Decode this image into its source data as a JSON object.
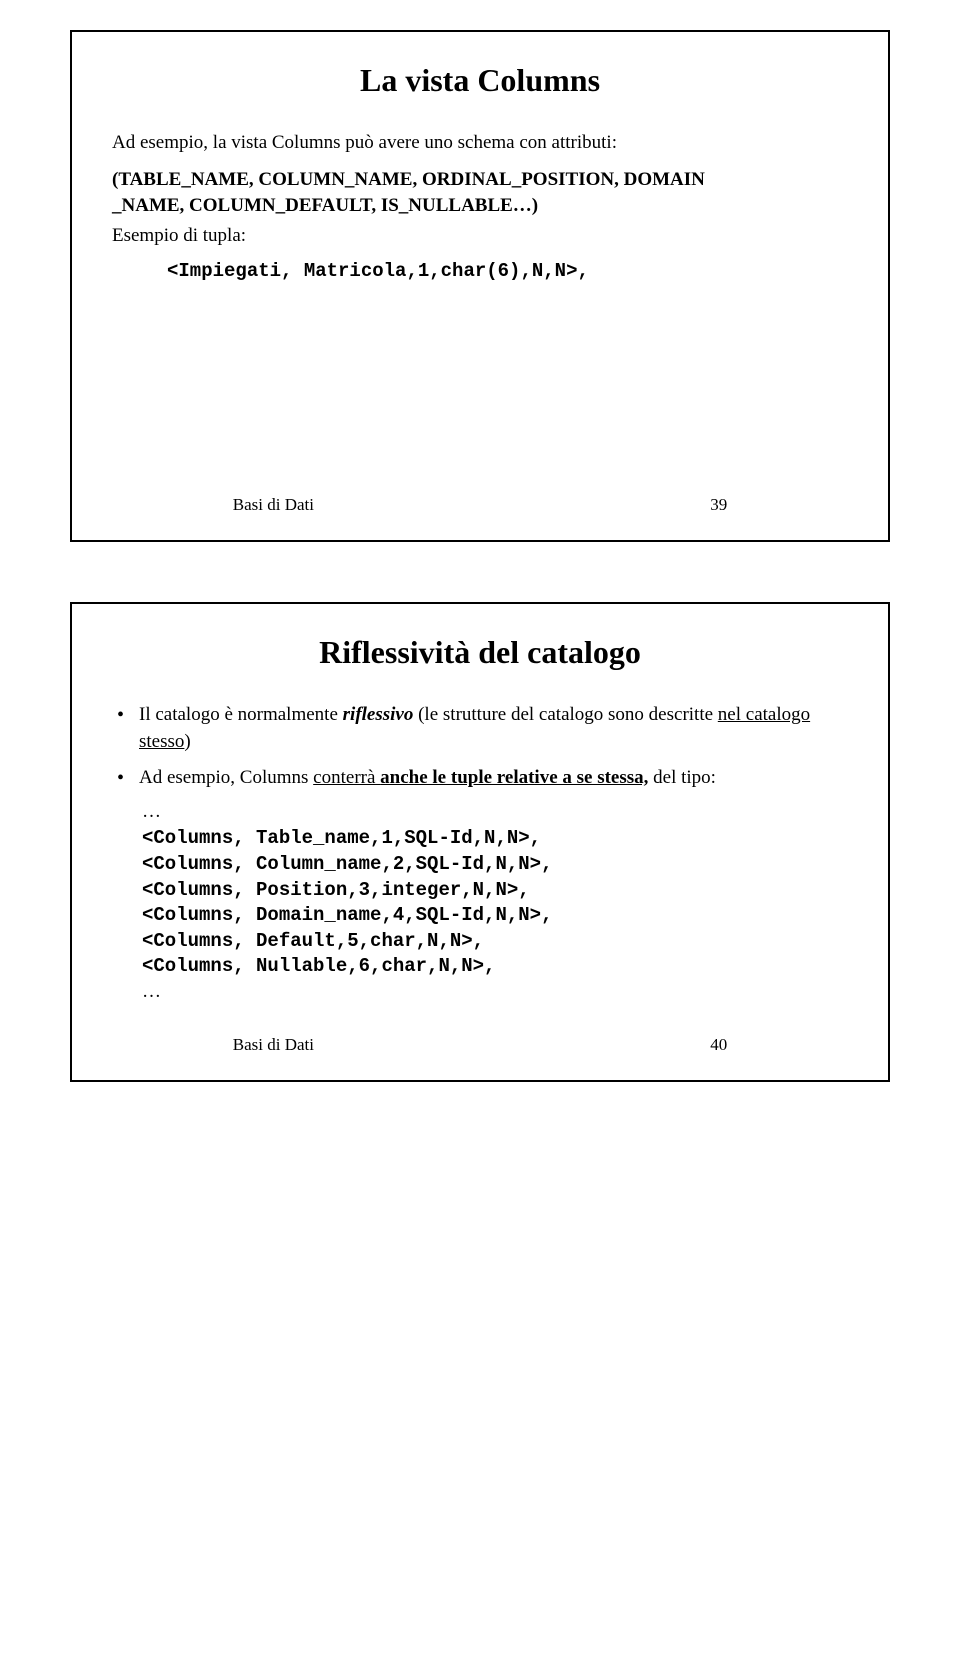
{
  "slide1": {
    "title": "La vista Columns",
    "intro": "Ad esempio, la vista Columns può avere uno schema con attributi:",
    "attr_line1": "(TABLE_NAME, COLUMN_NAME, ORDINAL_POSITION, DOMAIN",
    "attr_line2": "_NAME, COLUMN_DEFAULT, IS_NULLABLE…)",
    "example_label": "Esempio di tupla:",
    "tuple": "<Impiegati, Matricola,1,char(6),N,N>,",
    "footer_label": "Basi di Dati",
    "footer_num": "39"
  },
  "slide2": {
    "title": "Riflessività del catalogo",
    "bullet1_a": "Il catalogo è normalmente ",
    "bullet1_b": "riflessivo",
    "bullet1_c": " (le strutture del catalogo sono descritte ",
    "bullet1_d": "nel catalogo stesso",
    "bullet1_e": ")",
    "bullet2_a": "Ad esempio, Columns ",
    "bullet2_b": "conterrà ",
    "bullet2_c": "anche le tuple  relative a se stessa,",
    "bullet2_d": " del tipo:",
    "ellipsis_top": "…",
    "code1": "<Columns, Table_name,1,SQL-Id,N,N>,",
    "code2": "<Columns, Column_name,2,SQL-Id,N,N>,",
    "code3": "<Columns, Position,3,integer,N,N>,",
    "code4": "<Columns, Domain_name,4,SQL-Id,N,N>,",
    "code5": "<Columns, Default,5,char,N,N>,",
    "code6": "<Columns, Nullable,6,char,N,N>,",
    "ellipsis_bottom": "…",
    "footer_label": "Basi di Dati",
    "footer_num": "40"
  }
}
